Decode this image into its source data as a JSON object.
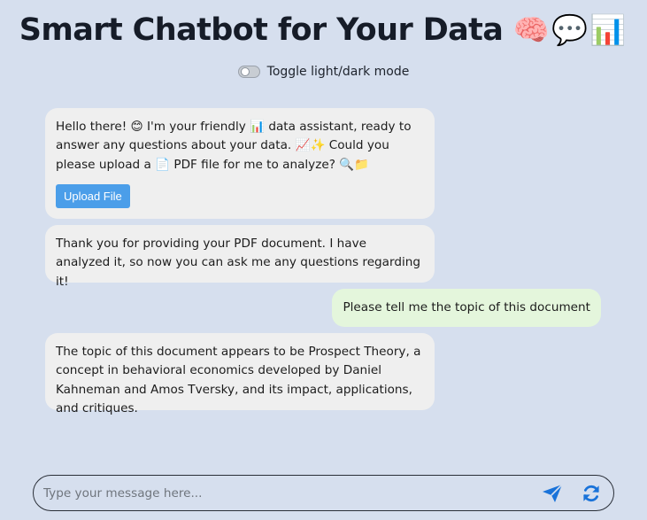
{
  "header": {
    "title": "Smart Chatbot for Your Data",
    "emojis": "🧠💬📊"
  },
  "theme_toggle": {
    "label": "Toggle light/dark mode",
    "state": "off"
  },
  "messages": [
    {
      "role": "bot",
      "text": "Hello there! 😊 I'm your friendly 📊 data assistant, ready to answer any questions about your data. 📈✨ Could you please upload a 📄 PDF file for me to analyze? 🔍📁",
      "button_label": "Upload File"
    },
    {
      "role": "bot",
      "text": "Thank you for providing your PDF document. I have analyzed it, so now you can ask me any questions regarding it!"
    },
    {
      "role": "user",
      "text": "Please tell me the topic of this document"
    },
    {
      "role": "bot",
      "text": "The topic of this document appears to be Prospect Theory, a concept in behavioral economics developed by Daniel Kahneman and Amos Tversky, and its impact, applications, and critiques."
    }
  ],
  "composer": {
    "placeholder": "Type your message here...",
    "value": "",
    "send_icon": "send-icon",
    "refresh_icon": "refresh-icon"
  },
  "colors": {
    "background": "#d6dfee",
    "bot_bubble": "#efefef",
    "user_bubble": "#e4f6dc",
    "accent": "#1a73d9",
    "upload_button": "#4b9ee9"
  }
}
